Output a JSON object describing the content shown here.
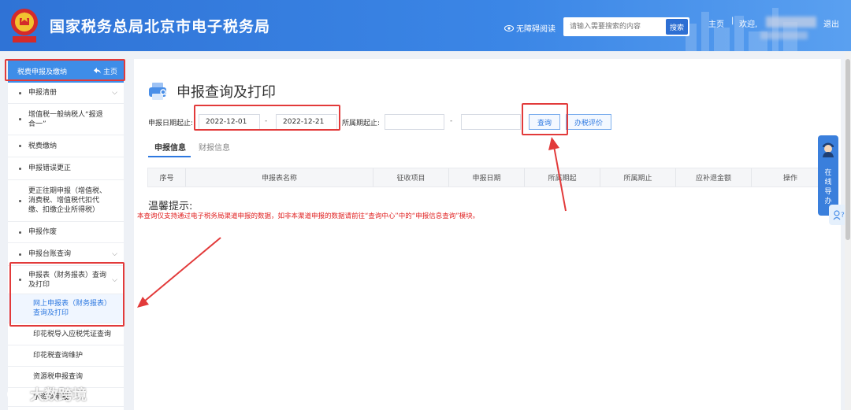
{
  "header": {
    "site_title": "国家税务总局北京市电子税务局",
    "accessibility": "无障碍阅读",
    "search_placeholder": "请输入需要搜索的内容",
    "search_button": "搜索",
    "home": "主页",
    "separator": "|",
    "welcome": "欢迎,",
    "logout": "退出"
  },
  "sidebar": {
    "top_item": "税费申报及缴纳",
    "top_home": "主页",
    "items": [
      {
        "label": "申报清册",
        "chev": "⌵"
      },
      {
        "label": "增值税一般纳税人“报退合一”",
        "chev": ""
      },
      {
        "label": "税费缴纳",
        "chev": ""
      },
      {
        "label": "申报错误更正",
        "chev": ""
      },
      {
        "label": "更正往期申报（增值税、消费税、增值税代扣代缴、扣缴企业所得税）",
        "chev": ""
      },
      {
        "label": "申报作废",
        "chev": ""
      },
      {
        "label": "申报台账查询",
        "chev": "⌵"
      },
      {
        "label": "申报表（财务报表）查询及打印",
        "chev": "⌵"
      }
    ],
    "subitems": [
      {
        "label": "网上申报表（财务报表）查询及打印"
      },
      {
        "label": "印花税导入应税凭证查询"
      },
      {
        "label": "印花税查询维护"
      },
      {
        "label": "资源税申报查询"
      },
      {
        "label": "水资源申报"
      }
    ]
  },
  "main": {
    "title": "申报查询及打印",
    "filters": {
      "date_label": "申报日期起止:",
      "date_start": "2022-12-01",
      "date_dash": "-",
      "date_end": "2022-12-21",
      "period_label": "所属期起止:",
      "period_start": "",
      "period_dash": "-",
      "period_end": "",
      "query_button": "查询",
      "evaluate_button": "办税评价"
    },
    "tabs": [
      "申报信息",
      "财报信息"
    ],
    "table_headers": [
      "序号",
      "申报表名称",
      "征收项目",
      "申报日期",
      "所属期起",
      "所属期止",
      "应补退金额",
      "操作"
    ],
    "tip_title": "温馨提示:",
    "tip_text": "本查询仅支持通过电子税务局渠道申报的数据，如非本渠道申报的数据请前往“查询中心”中的“申报信息查询”模块。"
  },
  "float_guide": {
    "text": [
      "在",
      "线",
      "导",
      "办"
    ]
  },
  "watermark": "大数跨境",
  "colors": {
    "header_blue": "#2f73d6",
    "accent_blue": "#2d78e0",
    "warning_red": "#e02020",
    "annotation_red": "#e23a3a"
  }
}
